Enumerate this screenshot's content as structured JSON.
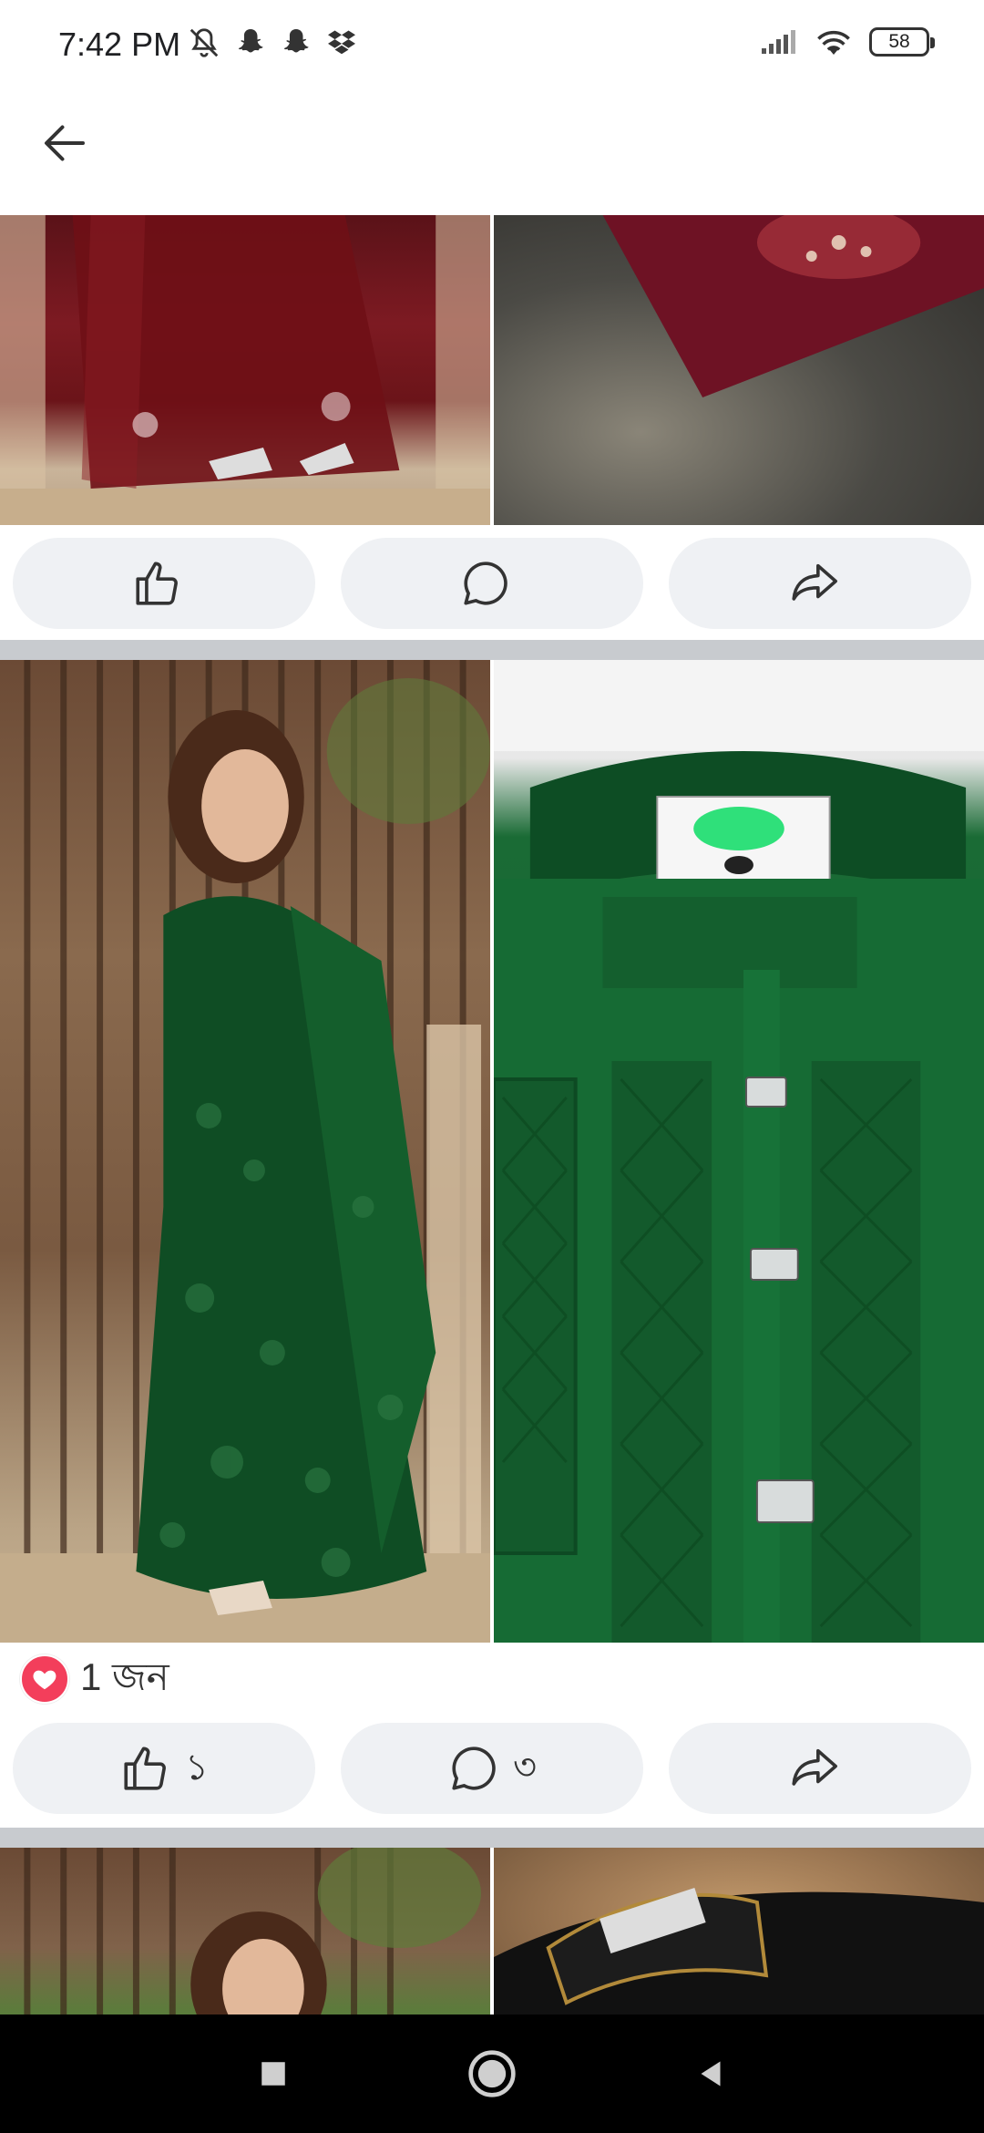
{
  "status_bar": {
    "time": "7:42 PM",
    "battery": "58",
    "icons": [
      "mute-icon",
      "snapchat-icon",
      "snapchat-icon",
      "dropbox-icon",
      "signal-icon",
      "wifi-icon",
      "battery-icon"
    ]
  },
  "app_bar": {
    "back_icon": "arrow-left-icon"
  },
  "post1": {
    "photos": [
      "maroon lace saree bottom",
      "maroon kurta on fur"
    ],
    "actions": {
      "like_label": "",
      "comment_label": "",
      "share_label": ""
    }
  },
  "post2": {
    "photos": [
      "woman in green lace saree",
      "green embroidered kurta"
    ],
    "reaction_count": "1 জন",
    "actions": {
      "like_label": "১",
      "comment_label": "৩",
      "share_label": ""
    }
  },
  "post3": {
    "photos": [
      "woman smiling near gate",
      "black kurta on fur"
    ]
  },
  "colors": {
    "accent_love": "#f33e5b",
    "pill_bg": "#eff1f4",
    "divider": "#c8cbcf"
  }
}
